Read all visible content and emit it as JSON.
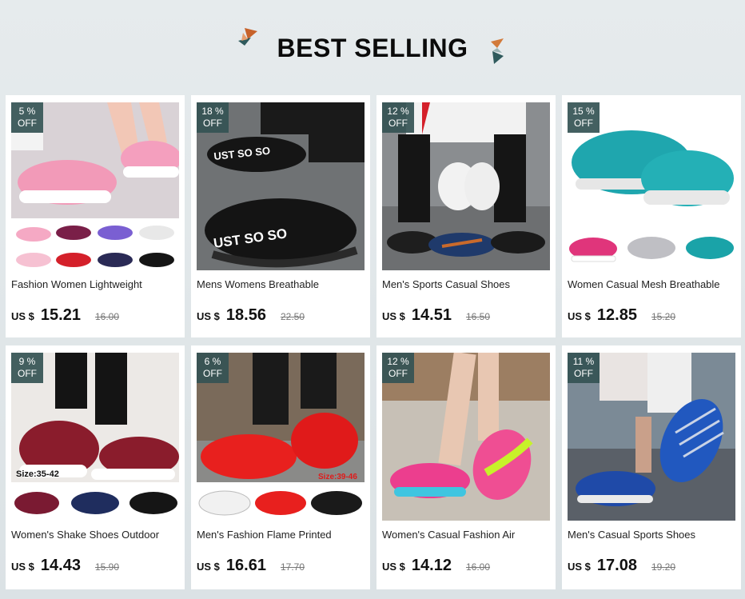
{
  "header": {
    "title": "BEST SELLING"
  },
  "colors": {
    "badge": "#345254",
    "accent_orange": "#c96a2b",
    "accent_teal": "#2b5a5e"
  },
  "products": [
    {
      "discount": "5 %",
      "off": "OFF",
      "name": "Fashion Women Lightweight",
      "currency": "US $",
      "price": "15.21",
      "old_price": "16.00",
      "size_label": ""
    },
    {
      "discount": "18 %",
      "off": "OFF",
      "name": "Mens Womens Breathable",
      "currency": "US $",
      "price": "18.56",
      "old_price": "22.50",
      "size_label": ""
    },
    {
      "discount": "12 %",
      "off": "OFF",
      "name": "Men's Sports Casual Shoes",
      "currency": "US $",
      "price": "14.51",
      "old_price": "16.50",
      "size_label": ""
    },
    {
      "discount": "15 %",
      "off": "OFF",
      "name": "Women Casual Mesh Breathable",
      "currency": "US $",
      "price": "12.85",
      "old_price": "15.20",
      "size_label": ""
    },
    {
      "discount": "9 %",
      "off": "OFF",
      "name": "Women's Shake Shoes Outdoor",
      "currency": "US $",
      "price": "14.43",
      "old_price": "15.90",
      "size_label": "Size:35-42"
    },
    {
      "discount": "6 %",
      "off": "OFF",
      "name": "Men's Fashion Flame Printed",
      "currency": "US $",
      "price": "16.61",
      "old_price": "17.70",
      "size_label": "Size:39-46"
    },
    {
      "discount": "12 %",
      "off": "OFF",
      "name": "Women's Casual Fashion Air",
      "currency": "US $",
      "price": "14.12",
      "old_price": "16.00",
      "size_label": ""
    },
    {
      "discount": "11 %",
      "off": "OFF",
      "name": "Men's Casual Sports Shoes",
      "currency": "US $",
      "price": "17.08",
      "old_price": "19.20",
      "size_label": ""
    }
  ]
}
